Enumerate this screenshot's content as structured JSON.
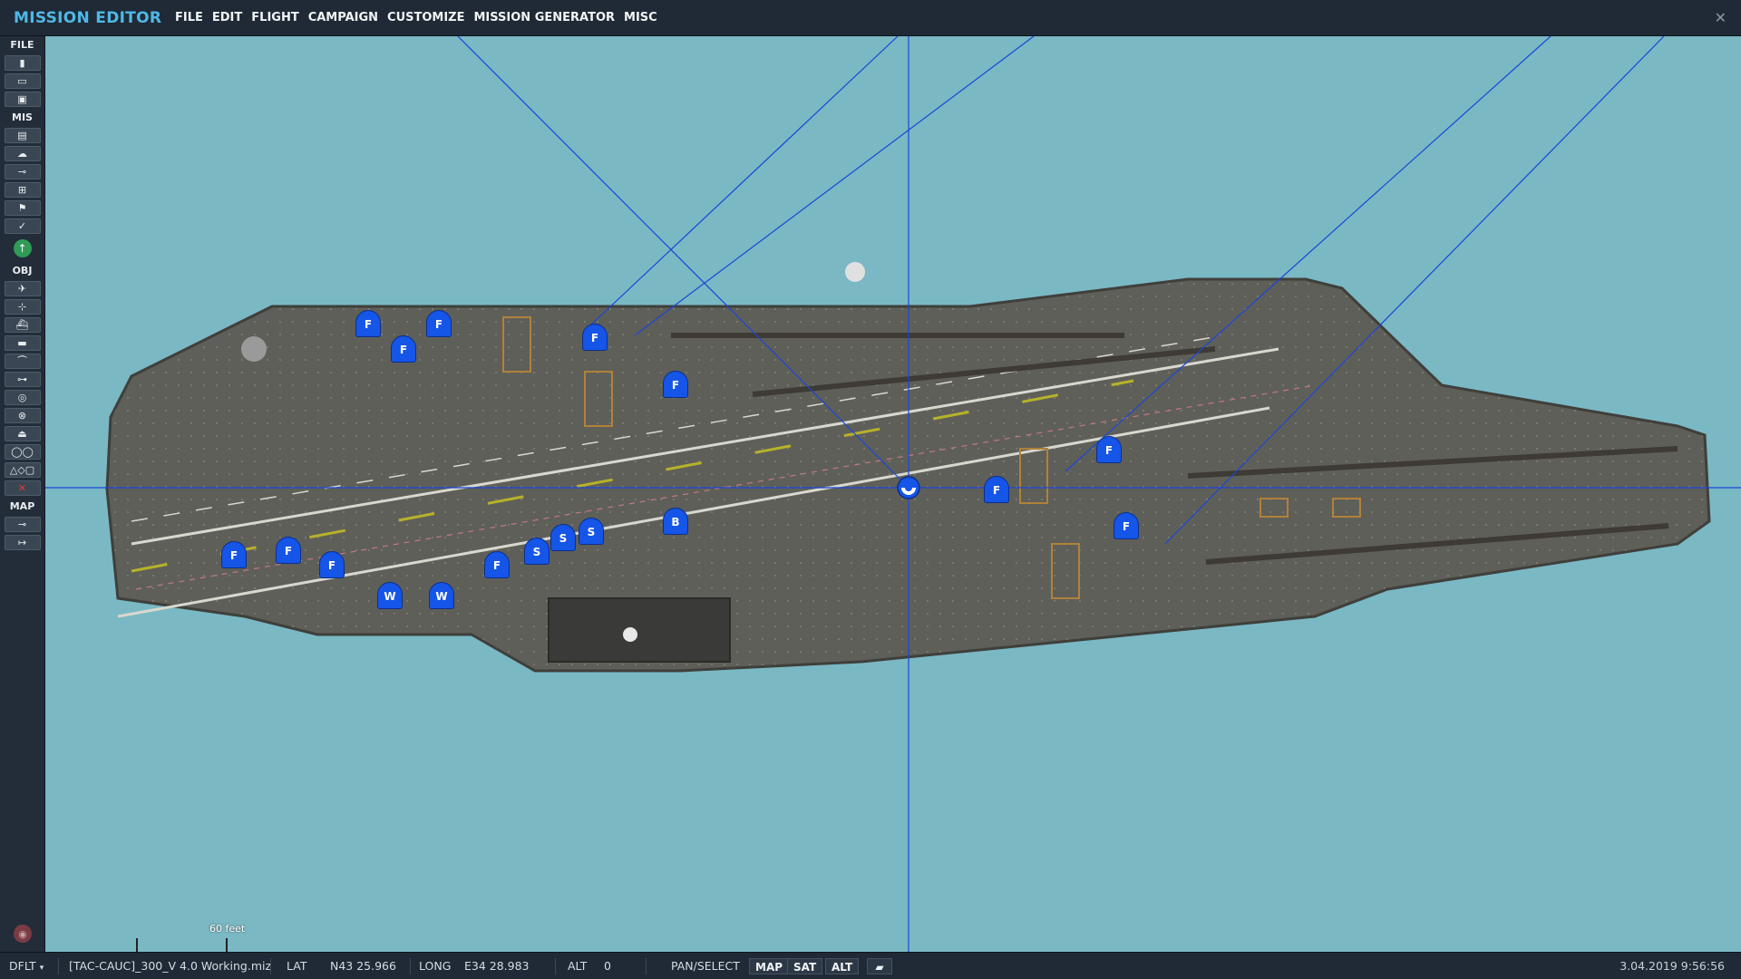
{
  "app": {
    "title": "MISSION EDITOR"
  },
  "menu": [
    "FILE",
    "EDIT",
    "FLIGHT",
    "CAMPAIGN",
    "CUSTOMIZE",
    "MISSION GENERATOR",
    "MISC"
  ],
  "toolbar": {
    "sections": {
      "file": "FILE",
      "mis": "MIS",
      "obj": "OBJ",
      "map": "MAP"
    }
  },
  "units": [
    {
      "letter": "F"
    },
    {
      "letter": "F"
    },
    {
      "letter": "F"
    },
    {
      "letter": "F"
    },
    {
      "letter": "F"
    },
    {
      "letter": "F"
    },
    {
      "letter": "F"
    },
    {
      "letter": "F"
    },
    {
      "letter": "F"
    },
    {
      "letter": "F"
    },
    {
      "letter": "F"
    },
    {
      "letter": "F"
    },
    {
      "letter": "W"
    },
    {
      "letter": "W"
    },
    {
      "letter": "S"
    },
    {
      "letter": "S"
    },
    {
      "letter": "S"
    },
    {
      "letter": "B"
    }
  ],
  "scale": {
    "label": "60 feet"
  },
  "status": {
    "profile": "DFLT",
    "filename": "[TAC-CAUC]_300_V 4.0 Working.miz",
    "lat_label": "LAT",
    "lat_value": "N43 25.966",
    "long_label": "LONG",
    "long_value": "E34 28.983",
    "alt_label": "ALT",
    "alt_value": "0",
    "mode": "PAN/SELECT",
    "btn_map": "MAP",
    "btn_sat": "SAT",
    "btn_alt": "ALT",
    "datetime": "3.04.2019 9:56:56"
  },
  "colors": {
    "sea": "#7ab8c4",
    "deck": "#5e5e58",
    "unit_blue": "#1555e8",
    "title_blue": "#4fb8e6"
  }
}
